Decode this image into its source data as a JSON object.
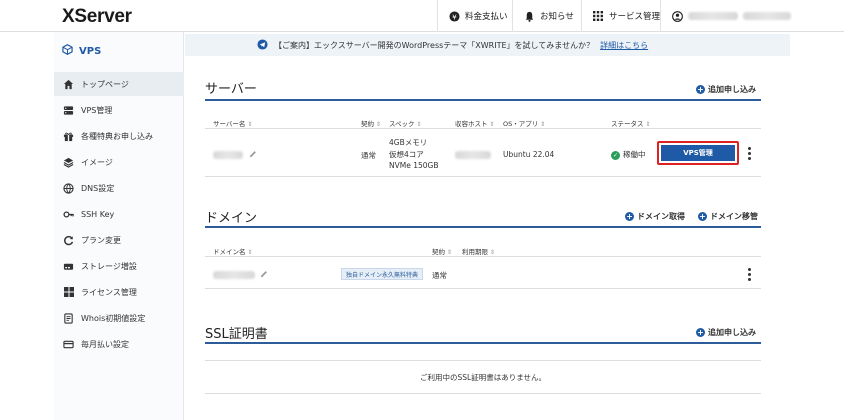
{
  "header": {
    "logo": "XServer",
    "payment": "料金支払い",
    "notice": "お知らせ",
    "services": "サービス管理"
  },
  "sidebar": {
    "title": "VPS",
    "items": [
      {
        "label": "トップページ",
        "icon": "home-icon"
      },
      {
        "label": "VPS管理",
        "icon": "server-icon"
      },
      {
        "label": "各種特典お申し込み",
        "icon": "gift-icon"
      },
      {
        "label": "イメージ",
        "icon": "layers-icon"
      },
      {
        "label": "DNS設定",
        "icon": "globe-icon"
      },
      {
        "label": "SSH Key",
        "icon": "key-icon"
      },
      {
        "label": "プラン変更",
        "icon": "refresh-icon"
      },
      {
        "label": "ストレージ増設",
        "icon": "storage-icon"
      },
      {
        "label": "ライセンス管理",
        "icon": "windows-icon"
      },
      {
        "label": "Whois初期値設定",
        "icon": "document-icon"
      },
      {
        "label": "毎月払い設定",
        "icon": "card-icon"
      }
    ]
  },
  "notice_bar": {
    "text": "【ご案内】エックスサーバー開発のWordPressテーマ「XWRITE」を試してみませんか？",
    "link": "詳細はこちら"
  },
  "server": {
    "title": "サーバー",
    "add_link": "追加申し込み",
    "headers": {
      "name": "サーバー名",
      "contract": "契約",
      "spec": "スペック",
      "host": "収容ホスト",
      "os": "OS・アプリ",
      "status": "ステータス"
    },
    "row": {
      "contract": "通常",
      "spec_memory": "4GBメモリ",
      "spec_cpu": "仮想4コア",
      "spec_disk": "NVMe 150GB",
      "os": "Ubuntu 22.04",
      "status": "稼働中",
      "button": "VPS管理"
    }
  },
  "domain": {
    "title": "ドメイン",
    "acquire_link": "ドメイン取得",
    "transfer_link": "ドメイン移管",
    "headers": {
      "name": "ドメイン名",
      "contract": "契約",
      "expiry": "利用期限"
    },
    "row": {
      "badge": "独自ドメイン永久無料特典",
      "contract": "通常"
    }
  },
  "ssl": {
    "title": "SSL証明書",
    "add_link": "追加申し込み",
    "empty": "ご利用中のSSL証明書はありません。"
  },
  "colors": {
    "brand": "#1f5aa6",
    "highlight": "#dd2222",
    "status_ok": "#2a9d5b"
  }
}
